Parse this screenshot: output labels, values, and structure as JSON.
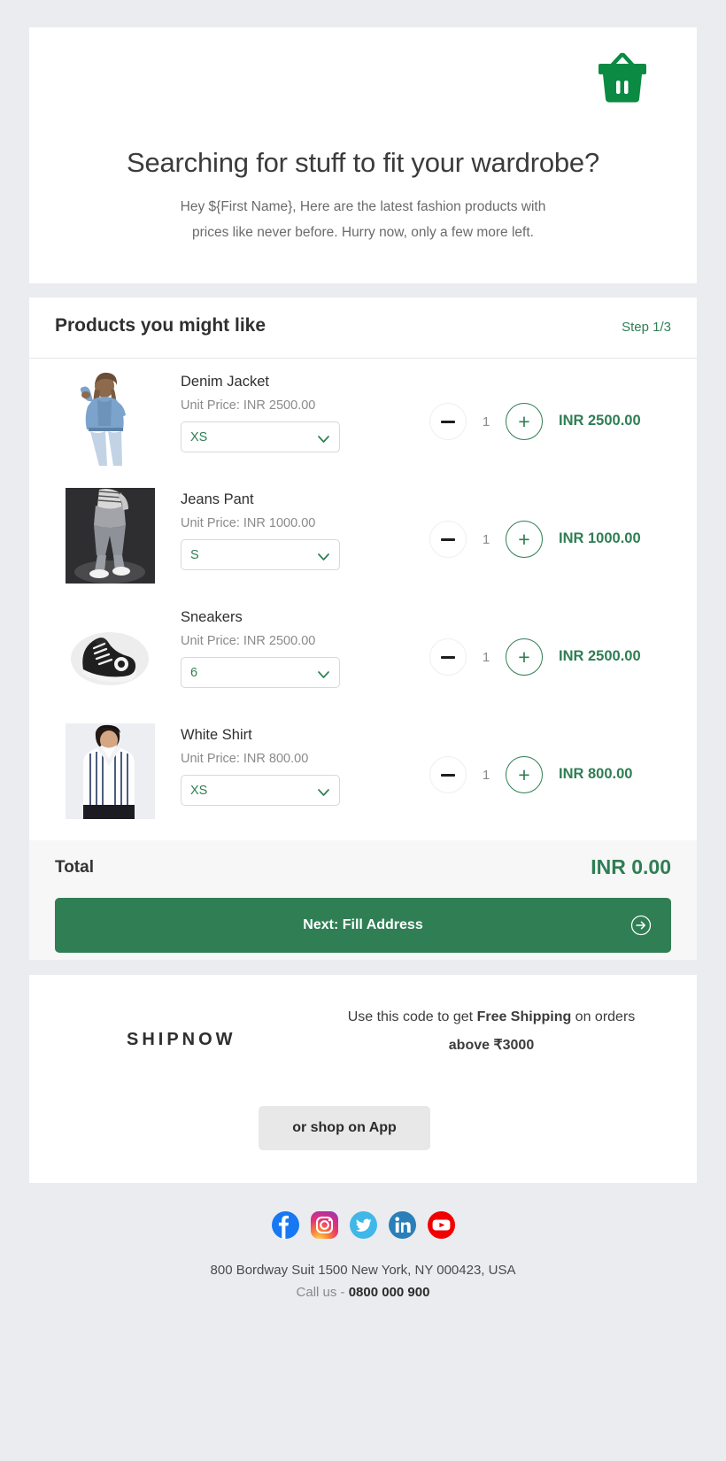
{
  "hero": {
    "basket_icon": "shopping-basket-icon",
    "title": "Searching for stuff to fit your wardrobe?",
    "subtitle_line1": "Hey ${First Name}, Here are the latest fashion products with",
    "subtitle_line2": "prices like never before. Hurry now, only a few more left."
  },
  "products": {
    "heading": "Products you might like",
    "step": "Step 1/3",
    "items": [
      {
        "name": "Denim Jacket",
        "unit_price": "Unit Price: INR 2500.00",
        "size": "XS",
        "quantity": "1",
        "line_total": "INR 2500.00",
        "image": "denim-jacket-photo"
      },
      {
        "name": "Jeans Pant",
        "unit_price": "Unit Price: INR 1000.00",
        "size": "S",
        "quantity": "1",
        "line_total": "INR 1000.00",
        "image": "jeans-pant-photo"
      },
      {
        "name": "Sneakers",
        "unit_price": "Unit Price: INR 2500.00",
        "size": "6",
        "quantity": "1",
        "line_total": "INR 2500.00",
        "image": "sneakers-photo"
      },
      {
        "name": "White Shirt",
        "unit_price": "Unit Price: INR 800.00",
        "size": "XS",
        "quantity": "1",
        "line_total": "INR 800.00",
        "image": "white-shirt-photo"
      }
    ],
    "minus_label": "decrease-quantity",
    "plus_label": "increase-quantity"
  },
  "total": {
    "label": "Total",
    "value": "INR 0.00",
    "next_button": "Next: Fill Address"
  },
  "promo": {
    "code": "SHIPNOW",
    "text_part1": "Use this code to get ",
    "text_bold1": "Free Shipping",
    "text_part2": " on orders ",
    "text_bold2": "above ₹3000",
    "app_button": "or shop on App"
  },
  "footer": {
    "socials": [
      "facebook-icon",
      "instagram-icon",
      "twitter-icon",
      "linkedin-icon",
      "youtube-icon"
    ],
    "address": "800 Bordway Suit 1500 New York, NY 000423, USA",
    "call_prefix": "Call us - ",
    "call_number": "0800 000 900"
  },
  "colors": {
    "brand_green": "#2f7e54",
    "page_bg": "#ebecf0",
    "card_bg": "#ffffff",
    "total_bg": "#f7f7f7"
  }
}
